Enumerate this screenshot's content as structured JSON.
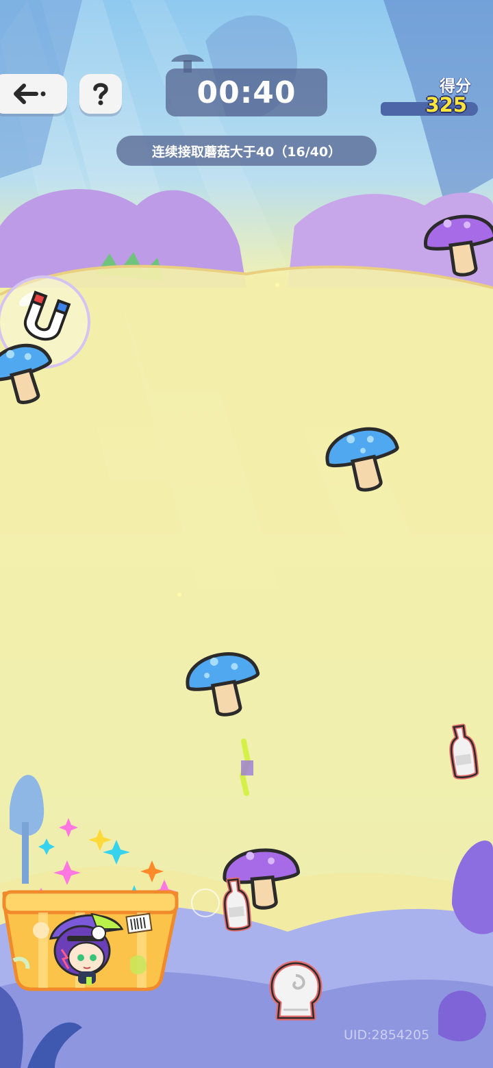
{
  "hud": {
    "back_icon": "arrow-left-icon",
    "help_icon": "question-mark-icon",
    "timer": "00:40",
    "mission_text": "连续接取蘑菇大于40（16/40）",
    "score_label": "得分",
    "score_value": "325"
  },
  "footer": {
    "uid": "UID:2854205"
  },
  "items": {
    "blue_mushroom": "blue-mushroom-icon",
    "purple_mushroom": "purple-mushroom-icon",
    "bottle": "bottle-icon",
    "shell": "shell-icon",
    "magnet": "magnet-bubble-icon"
  },
  "player": {
    "basket": "basket-icon",
    "character": "character-avatar"
  },
  "colors": {
    "hud_panel": "#52608c",
    "score_yellow": "#ffe53a",
    "blue_mushroom": "#4fa8f0",
    "purple_mushroom": "#a86be8"
  }
}
